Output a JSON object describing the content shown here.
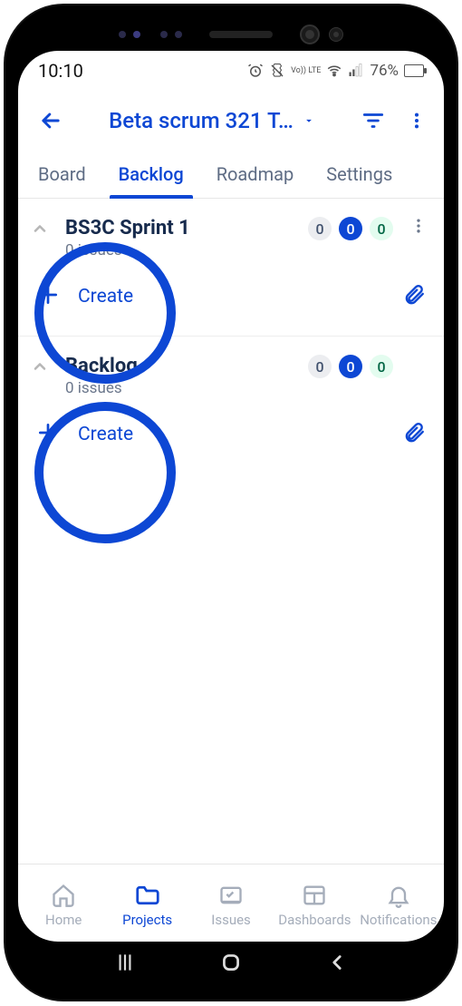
{
  "status": {
    "time": "10:10",
    "network_label": "Vo)) LTE",
    "battery_percent": "76%"
  },
  "header": {
    "title": "Beta scrum 321 T…"
  },
  "tabs": [
    {
      "label": "Board",
      "active": false
    },
    {
      "label": "Backlog",
      "active": true
    },
    {
      "label": "Roadmap",
      "active": false
    },
    {
      "label": "Settings",
      "active": false
    }
  ],
  "sections": [
    {
      "title": "BS3C Sprint 1",
      "subtitle": "0 issues",
      "badges": {
        "todo": "0",
        "inprog": "0",
        "done": "0"
      },
      "has_kebab": true,
      "create_label": "Create"
    },
    {
      "title": "Backlog",
      "subtitle": "0 issues",
      "badges": {
        "todo": "0",
        "inprog": "0",
        "done": "0"
      },
      "has_kebab": false,
      "create_label": "Create"
    }
  ],
  "bottom_nav": [
    {
      "label": "Home",
      "icon": "home",
      "active": false
    },
    {
      "label": "Projects",
      "icon": "folder",
      "active": true
    },
    {
      "label": "Issues",
      "icon": "issues",
      "active": false
    },
    {
      "label": "Dashboards",
      "icon": "dashboards",
      "active": false
    },
    {
      "label": "Notifications",
      "icon": "bell",
      "active": false
    }
  ],
  "colors": {
    "accent": "#0d47d4",
    "muted": "#6b778c"
  }
}
